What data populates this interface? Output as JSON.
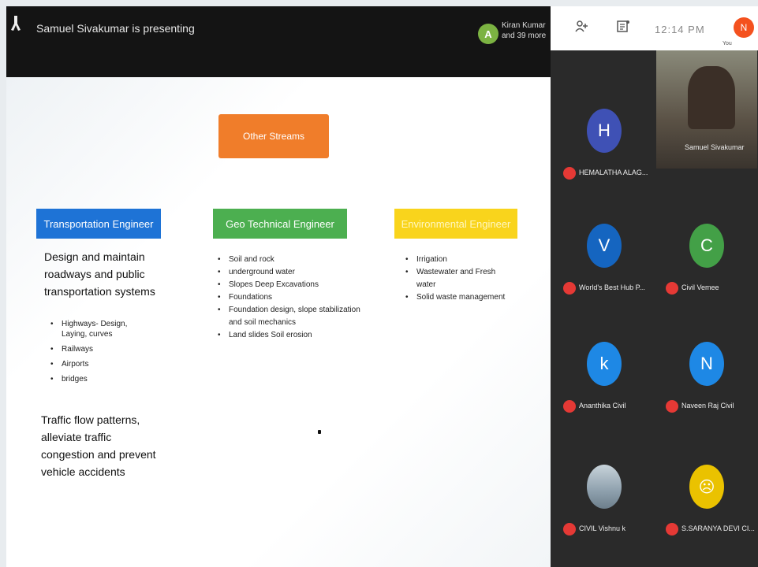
{
  "presenter_bar": {
    "status": "Samuel Sivakumar is presenting",
    "participant_initial": "A",
    "participant_name": "Kiran Kumar",
    "participant_more": "and 39 more"
  },
  "header": {
    "time": "12:14 PM",
    "my_initial": "N",
    "my_label": "You",
    "icons": [
      "people-icon",
      "chat-icon"
    ]
  },
  "slide": {
    "top_box": "Other Streams",
    "columns": [
      {
        "title": "Transportation Engineer",
        "color": "#1e73d6",
        "description": "Design and maintain roadways and public transportation systems",
        "items": [
          "Highways- Design, Laying, curves",
          "Railways",
          "Airports",
          "bridges"
        ],
        "footer": "Traffic flow patterns, alleviate traffic congestion and prevent vehicle accidents"
      },
      {
        "title": "Geo Technical Engineer",
        "color": "#4caf50",
        "items": [
          "Soil and rock",
          "underground water",
          "Slopes Deep Excavations",
          "Foundations",
          "Foundation design, slope stabilization and soil mechanics",
          "Land slides Soil erosion"
        ]
      },
      {
        "title": "Environmental Engineer",
        "color": "#f9d41c",
        "items": [
          "Irrigation",
          "Wastewater and Fresh water",
          "Solid waste management"
        ]
      }
    ]
  },
  "participants": [
    {
      "initial": "H",
      "name": "HEMALATHA ALAG...",
      "color": "#3f51b5"
    },
    {
      "initial": "",
      "name": "Samuel Sivakumar",
      "color": ""
    },
    {
      "initial": "V",
      "name": "World's Best Hub P...",
      "color": "#1565c0"
    },
    {
      "initial": "C",
      "name": "Civil Vemee",
      "color": "#43a047"
    },
    {
      "initial": "k",
      "name": "Ananthika Civil",
      "color": "#1e88e5"
    },
    {
      "initial": "N",
      "name": "Naveen Raj Civil",
      "color": "#1e88e5"
    },
    {
      "initial": "",
      "name": "CIVIL Vishnu k",
      "color": ""
    },
    {
      "initial": "",
      "name": "S.SARANYA DEVI CI...",
      "color": "#eac200"
    }
  ]
}
